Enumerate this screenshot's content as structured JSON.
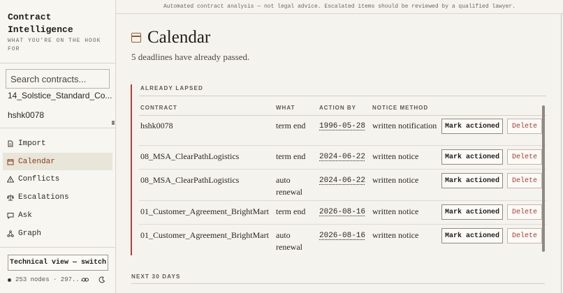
{
  "app": {
    "brand": "Contract Intelligence",
    "tagline": "WHAT YOU'RE ON THE HOOK FOR"
  },
  "banner": "Automated contract analysis — not legal advice. Escalated items should be reviewed by a qualified lawyer.",
  "sidebar": {
    "search_placeholder": "Search contracts...",
    "recent": [
      "14_Solstice_Standard_Co...",
      "hshk0078"
    ],
    "nav": [
      {
        "label": "Import",
        "icon": "document-icon"
      },
      {
        "label": "Calendar",
        "icon": "calendar-icon",
        "active": true
      },
      {
        "label": "Conflicts",
        "icon": "warning-icon"
      },
      {
        "label": "Escalations",
        "icon": "scales-icon"
      },
      {
        "label": "Ask",
        "icon": "chat-icon"
      },
      {
        "label": "Graph",
        "icon": "graph-icon"
      }
    ],
    "tech_button": "Technical view — switch",
    "status": "253 nodes · 297..."
  },
  "main": {
    "title": "Calendar",
    "subtitle": "5 deadlines have already passed.",
    "lapsed_heading": "ALREADY LAPSED",
    "columns": {
      "contract": "CONTRACT",
      "what": "WHAT",
      "action_by": "ACTION BY",
      "notice": "NOTICE METHOD"
    },
    "rows": [
      {
        "contract": "hshk0078",
        "what": "term end",
        "date": "1996-05-28",
        "notice": "written notification"
      },
      {
        "contract": "08_MSA_ClearPathLogistics",
        "what": "term end",
        "date": "2024-06-22",
        "notice": "written notice"
      },
      {
        "contract": "08_MSA_ClearPathLogistics",
        "what": "auto renewal",
        "date": "2024-06-22",
        "notice": "written notice"
      },
      {
        "contract": "01_Customer_Agreement_BrightMart",
        "what": "term end",
        "date": "2026-08-16",
        "notice": "written notice"
      },
      {
        "contract": "01_Customer_Agreement_BrightMart",
        "what": "auto renewal",
        "date": "2026-08-16",
        "notice": "written notice"
      }
    ],
    "mark_label": "Mark actioned",
    "delete_label": "Delete",
    "next_heading": "NEXT 30 DAYS"
  },
  "colors": {
    "accent": "#8a3b17",
    "lapsed_border": "#b0413a",
    "delete": "#a83a2c"
  }
}
